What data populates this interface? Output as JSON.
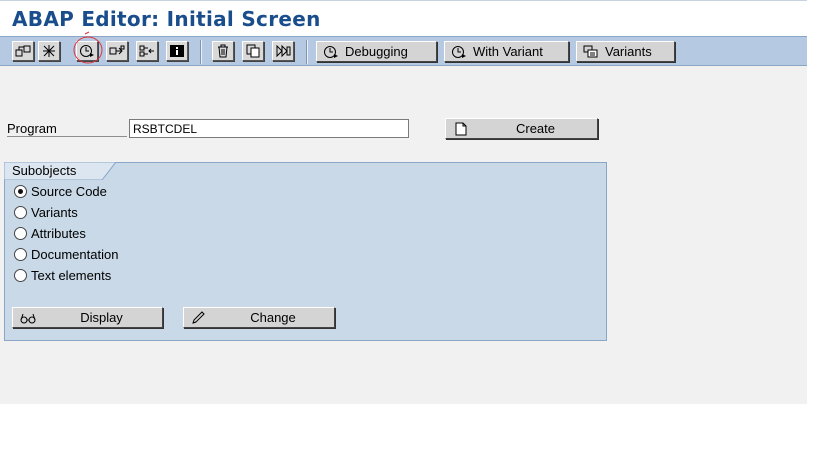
{
  "window": {
    "title": "ABAP Editor: Initial Screen"
  },
  "toolbar": {
    "debugging_label": "Debugging",
    "with_variant_label": "With Variant",
    "variants_label": "Variants"
  },
  "program": {
    "label": "Program",
    "value": "RSBTCDEL"
  },
  "create_button": {
    "label": "Create"
  },
  "subobjects": {
    "title": "Subobjects",
    "options": [
      {
        "label": "Source Code",
        "selected": true
      },
      {
        "label": "Variants",
        "selected": false
      },
      {
        "label": "Attributes",
        "selected": false
      },
      {
        "label": "Documentation",
        "selected": false
      },
      {
        "label": "Text elements",
        "selected": false
      }
    ]
  },
  "actions": {
    "display_label": "Display",
    "change_label": "Change"
  },
  "colors": {
    "title": "#1a4d8c",
    "toolbar": "#b6c9e2",
    "group": "#c9d9e8",
    "highlight_circle": "#e0303a"
  }
}
